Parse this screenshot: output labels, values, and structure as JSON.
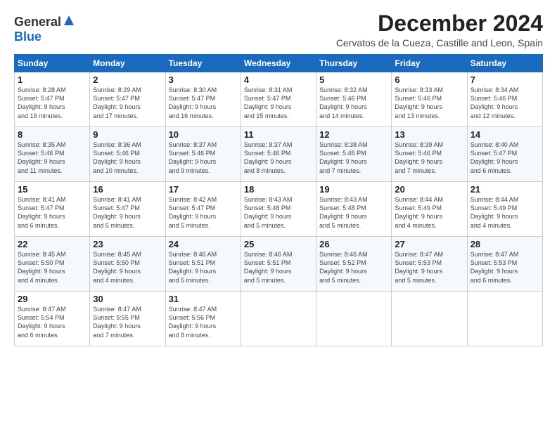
{
  "header": {
    "logo_general": "General",
    "logo_blue": "Blue",
    "month_title": "December 2024",
    "location": "Cervatos de la Cueza, Castille and Leon, Spain"
  },
  "columns": [
    "Sunday",
    "Monday",
    "Tuesday",
    "Wednesday",
    "Thursday",
    "Friday",
    "Saturday"
  ],
  "weeks": [
    [
      {
        "day": "1",
        "info": "Sunrise: 8:28 AM\nSunset: 5:47 PM\nDaylight: 9 hours\nand 19 minutes."
      },
      {
        "day": "2",
        "info": "Sunrise: 8:29 AM\nSunset: 5:47 PM\nDaylight: 9 hours\nand 17 minutes."
      },
      {
        "day": "3",
        "info": "Sunrise: 8:30 AM\nSunset: 5:47 PM\nDaylight: 9 hours\nand 16 minutes."
      },
      {
        "day": "4",
        "info": "Sunrise: 8:31 AM\nSunset: 5:47 PM\nDaylight: 9 hours\nand 15 minutes."
      },
      {
        "day": "5",
        "info": "Sunrise: 8:32 AM\nSunset: 5:46 PM\nDaylight: 9 hours\nand 14 minutes."
      },
      {
        "day": "6",
        "info": "Sunrise: 8:33 AM\nSunset: 5:46 PM\nDaylight: 9 hours\nand 13 minutes."
      },
      {
        "day": "7",
        "info": "Sunrise: 8:34 AM\nSunset: 5:46 PM\nDaylight: 9 hours\nand 12 minutes."
      }
    ],
    [
      {
        "day": "8",
        "info": "Sunrise: 8:35 AM\nSunset: 5:46 PM\nDaylight: 9 hours\nand 11 minutes."
      },
      {
        "day": "9",
        "info": "Sunrise: 8:36 AM\nSunset: 5:46 PM\nDaylight: 9 hours\nand 10 minutes."
      },
      {
        "day": "10",
        "info": "Sunrise: 8:37 AM\nSunset: 5:46 PM\nDaylight: 9 hours\nand 9 minutes."
      },
      {
        "day": "11",
        "info": "Sunrise: 8:37 AM\nSunset: 5:46 PM\nDaylight: 9 hours\nand 8 minutes."
      },
      {
        "day": "12",
        "info": "Sunrise: 8:38 AM\nSunset: 5:46 PM\nDaylight: 9 hours\nand 7 minutes."
      },
      {
        "day": "13",
        "info": "Sunrise: 8:39 AM\nSunset: 5:46 PM\nDaylight: 9 hours\nand 7 minutes."
      },
      {
        "day": "14",
        "info": "Sunrise: 8:40 AM\nSunset: 5:47 PM\nDaylight: 9 hours\nand 6 minutes."
      }
    ],
    [
      {
        "day": "15",
        "info": "Sunrise: 8:41 AM\nSunset: 5:47 PM\nDaylight: 9 hours\nand 6 minutes."
      },
      {
        "day": "16",
        "info": "Sunrise: 8:41 AM\nSunset: 5:47 PM\nDaylight: 9 hours\nand 5 minutes."
      },
      {
        "day": "17",
        "info": "Sunrise: 8:42 AM\nSunset: 5:47 PM\nDaylight: 9 hours\nand 5 minutes."
      },
      {
        "day": "18",
        "info": "Sunrise: 8:43 AM\nSunset: 5:48 PM\nDaylight: 9 hours\nand 5 minutes."
      },
      {
        "day": "19",
        "info": "Sunrise: 8:43 AM\nSunset: 5:48 PM\nDaylight: 9 hours\nand 5 minutes."
      },
      {
        "day": "20",
        "info": "Sunrise: 8:44 AM\nSunset: 5:49 PM\nDaylight: 9 hours\nand 4 minutes."
      },
      {
        "day": "21",
        "info": "Sunrise: 8:44 AM\nSunset: 5:49 PM\nDaylight: 9 hours\nand 4 minutes."
      }
    ],
    [
      {
        "day": "22",
        "info": "Sunrise: 8:45 AM\nSunset: 5:50 PM\nDaylight: 9 hours\nand 4 minutes."
      },
      {
        "day": "23",
        "info": "Sunrise: 8:45 AM\nSunset: 5:50 PM\nDaylight: 9 hours\nand 4 minutes."
      },
      {
        "day": "24",
        "info": "Sunrise: 8:46 AM\nSunset: 5:51 PM\nDaylight: 9 hours\nand 5 minutes."
      },
      {
        "day": "25",
        "info": "Sunrise: 8:46 AM\nSunset: 5:51 PM\nDaylight: 9 hours\nand 5 minutes."
      },
      {
        "day": "26",
        "info": "Sunrise: 8:46 AM\nSunset: 5:52 PM\nDaylight: 9 hours\nand 5 minutes."
      },
      {
        "day": "27",
        "info": "Sunrise: 8:47 AM\nSunset: 5:53 PM\nDaylight: 9 hours\nand 5 minutes."
      },
      {
        "day": "28",
        "info": "Sunrise: 8:47 AM\nSunset: 5:53 PM\nDaylight: 9 hours\nand 6 minutes."
      }
    ],
    [
      {
        "day": "29",
        "info": "Sunrise: 8:47 AM\nSunset: 5:54 PM\nDaylight: 9 hours\nand 6 minutes."
      },
      {
        "day": "30",
        "info": "Sunrise: 8:47 AM\nSunset: 5:55 PM\nDaylight: 9 hours\nand 7 minutes."
      },
      {
        "day": "31",
        "info": "Sunrise: 8:47 AM\nSunset: 5:56 PM\nDaylight: 9 hours\nand 8 minutes."
      },
      {
        "day": "",
        "info": ""
      },
      {
        "day": "",
        "info": ""
      },
      {
        "day": "",
        "info": ""
      },
      {
        "day": "",
        "info": ""
      }
    ]
  ]
}
